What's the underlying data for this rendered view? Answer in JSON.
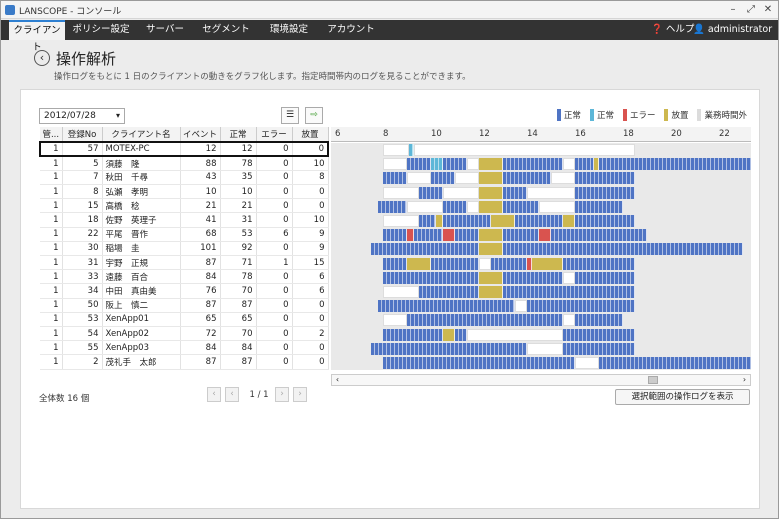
{
  "window": {
    "title": "LANSCOPE - コンソール"
  },
  "menu": {
    "tabs": [
      "クライアント",
      "ポリシー設定",
      "サーバー",
      "セグメント",
      "環境設定",
      "アカウント"
    ],
    "help": "ヘルプ",
    "user": "administrator"
  },
  "page": {
    "title": "操作解析",
    "description": "操作ログをもとに 1 日のクライアントの動きをグラフ化します。指定時間帯内のログを見ることができます。"
  },
  "toolbar": {
    "date": "2012/07/28"
  },
  "legend": [
    {
      "label": "正常",
      "color": "#4f74c4"
    },
    {
      "label": "正常",
      "color": "#5db7d8"
    },
    {
      "label": "エラー",
      "color": "#d9534f"
    },
    {
      "label": "放置",
      "color": "#cdb84f"
    },
    {
      "label": "業務時間外",
      "color": "#dcdcdc"
    }
  ],
  "columns": [
    "管...",
    "登録No",
    "クライアント名",
    "イベント",
    "正常",
    "エラー",
    "放置"
  ],
  "rows": [
    [
      "1",
      "57",
      "MOTEX-PC",
      "12",
      "12",
      "0",
      "0"
    ],
    [
      "1",
      "5",
      "須藤　隆",
      "88",
      "78",
      "0",
      "10"
    ],
    [
      "1",
      "7",
      "秋田　千尋",
      "43",
      "35",
      "0",
      "8"
    ],
    [
      "1",
      "8",
      "弘瀬　孝明",
      "10",
      "10",
      "0",
      "0"
    ],
    [
      "1",
      "15",
      "高橋　稔",
      "21",
      "21",
      "0",
      "0"
    ],
    [
      "1",
      "18",
      "佐野　英理子",
      "41",
      "31",
      "0",
      "10"
    ],
    [
      "1",
      "22",
      "平尾　晋作",
      "68",
      "53",
      "6",
      "9"
    ],
    [
      "1",
      "30",
      "稲場　圭",
      "101",
      "92",
      "0",
      "9"
    ],
    [
      "1",
      "31",
      "宇野　正規",
      "87",
      "71",
      "1",
      "15"
    ],
    [
      "1",
      "33",
      "遠藤　百合",
      "84",
      "78",
      "0",
      "6"
    ],
    [
      "1",
      "34",
      "中田　真由美",
      "76",
      "70",
      "0",
      "6"
    ],
    [
      "1",
      "50",
      "阪上　慎二",
      "87",
      "87",
      "0",
      "0"
    ],
    [
      "1",
      "53",
      "XenApp01",
      "65",
      "65",
      "0",
      "0"
    ],
    [
      "1",
      "54",
      "XenApp02",
      "72",
      "70",
      "0",
      "2"
    ],
    [
      "1",
      "55",
      "XenApp03",
      "84",
      "84",
      "0",
      "0"
    ],
    [
      "1",
      "2",
      "茂礼手　太郎",
      "87",
      "87",
      "0",
      "0"
    ]
  ],
  "timeline": {
    "hours": [
      "6",
      "8",
      "10",
      "12",
      "14",
      "16",
      "18",
      "20",
      "22"
    ],
    "activity": [
      [
        [
          8.0,
          9.1,
          "w"
        ],
        [
          9.1,
          9.3,
          "c"
        ],
        [
          9.3,
          18.5,
          "w"
        ]
      ],
      [
        [
          8.0,
          9.0,
          "w"
        ],
        [
          9.0,
          10.0,
          "b"
        ],
        [
          10.0,
          10.5,
          "c"
        ],
        [
          10.5,
          11.5,
          "b"
        ],
        [
          11.5,
          12.0,
          "w"
        ],
        [
          12.0,
          13.0,
          "y"
        ],
        [
          13.0,
          15.5,
          "b"
        ],
        [
          15.5,
          16.0,
          "w"
        ],
        [
          16.0,
          16.8,
          "b"
        ],
        [
          16.8,
          17.0,
          "y"
        ],
        [
          17.0,
          24.0,
          "b"
        ]
      ],
      [
        [
          8.0,
          9.0,
          "b"
        ],
        [
          9.0,
          10.0,
          "w"
        ],
        [
          10.0,
          11.0,
          "b"
        ],
        [
          11.0,
          12.0,
          "w"
        ],
        [
          12.0,
          13.0,
          "y"
        ],
        [
          13.0,
          15.0,
          "b"
        ],
        [
          15.0,
          16.0,
          "w"
        ],
        [
          16.0,
          18.5,
          "b"
        ]
      ],
      [
        [
          8.0,
          9.5,
          "w"
        ],
        [
          9.5,
          10.5,
          "b"
        ],
        [
          10.5,
          12.0,
          "w"
        ],
        [
          12.0,
          13.0,
          "y"
        ],
        [
          13.0,
          14.0,
          "b"
        ],
        [
          14.0,
          16.0,
          "w"
        ],
        [
          16.0,
          18.5,
          "b"
        ]
      ],
      [
        [
          7.8,
          9.0,
          "b"
        ],
        [
          9.0,
          10.5,
          "w"
        ],
        [
          10.5,
          11.5,
          "b"
        ],
        [
          11.5,
          12.0,
          "w"
        ],
        [
          12.0,
          13.0,
          "y"
        ],
        [
          13.0,
          14.5,
          "b"
        ],
        [
          14.5,
          16.0,
          "w"
        ],
        [
          16.0,
          18.0,
          "b"
        ]
      ],
      [
        [
          8.0,
          9.5,
          "w"
        ],
        [
          9.5,
          10.2,
          "b"
        ],
        [
          10.2,
          10.5,
          "y"
        ],
        [
          10.5,
          12.5,
          "b"
        ],
        [
          12.5,
          13.5,
          "y"
        ],
        [
          13.5,
          15.5,
          "b"
        ],
        [
          15.5,
          16.0,
          "y"
        ],
        [
          16.0,
          18.5,
          "b"
        ]
      ],
      [
        [
          8.0,
          9.0,
          "b"
        ],
        [
          9.0,
          9.3,
          "r"
        ],
        [
          9.3,
          10.5,
          "b"
        ],
        [
          10.5,
          11.0,
          "r"
        ],
        [
          11.0,
          12.0,
          "b"
        ],
        [
          12.0,
          13.0,
          "y"
        ],
        [
          13.0,
          14.5,
          "b"
        ],
        [
          14.5,
          15.0,
          "r"
        ],
        [
          15.0,
          19.0,
          "b"
        ]
      ],
      [
        [
          7.5,
          12.0,
          "b"
        ],
        [
          12.0,
          13.0,
          "y"
        ],
        [
          13.0,
          23.0,
          "b"
        ]
      ],
      [
        [
          8.0,
          9.0,
          "b"
        ],
        [
          9.0,
          10.0,
          "y"
        ],
        [
          10.0,
          12.0,
          "b"
        ],
        [
          12.0,
          12.5,
          "w"
        ],
        [
          12.5,
          14.0,
          "b"
        ],
        [
          14.0,
          14.2,
          "r"
        ],
        [
          14.2,
          15.5,
          "y"
        ],
        [
          15.5,
          18.5,
          "b"
        ]
      ],
      [
        [
          8.0,
          12.0,
          "b"
        ],
        [
          12.0,
          13.0,
          "y"
        ],
        [
          13.0,
          15.5,
          "b"
        ],
        [
          15.5,
          16.0,
          "w"
        ],
        [
          16.0,
          18.5,
          "b"
        ]
      ],
      [
        [
          8.0,
          9.5,
          "w"
        ],
        [
          9.5,
          12.0,
          "b"
        ],
        [
          12.0,
          13.0,
          "y"
        ],
        [
          13.0,
          18.5,
          "b"
        ]
      ],
      [
        [
          7.8,
          13.5,
          "b"
        ],
        [
          13.5,
          14.0,
          "w"
        ],
        [
          14.0,
          18.5,
          "b"
        ]
      ],
      [
        [
          8.0,
          9.0,
          "w"
        ],
        [
          9.0,
          15.5,
          "b"
        ],
        [
          15.5,
          16.0,
          "w"
        ],
        [
          16.0,
          18.0,
          "b"
        ]
      ],
      [
        [
          8.0,
          10.5,
          "b"
        ],
        [
          10.5,
          11.0,
          "y"
        ],
        [
          11.0,
          11.5,
          "b"
        ],
        [
          11.5,
          15.5,
          "w"
        ],
        [
          15.5,
          18.5,
          "b"
        ]
      ],
      [
        [
          7.5,
          14.0,
          "b"
        ],
        [
          14.0,
          15.5,
          "w"
        ],
        [
          15.5,
          18.5,
          "b"
        ]
      ],
      [
        [
          8.0,
          16.0,
          "b"
        ],
        [
          16.0,
          17.0,
          "w"
        ],
        [
          17.0,
          23.5,
          "b"
        ]
      ]
    ]
  },
  "footer": {
    "total": "全体数 16 個",
    "page": "1 / 1",
    "show_button": "選択範囲の操作ログを表示"
  }
}
